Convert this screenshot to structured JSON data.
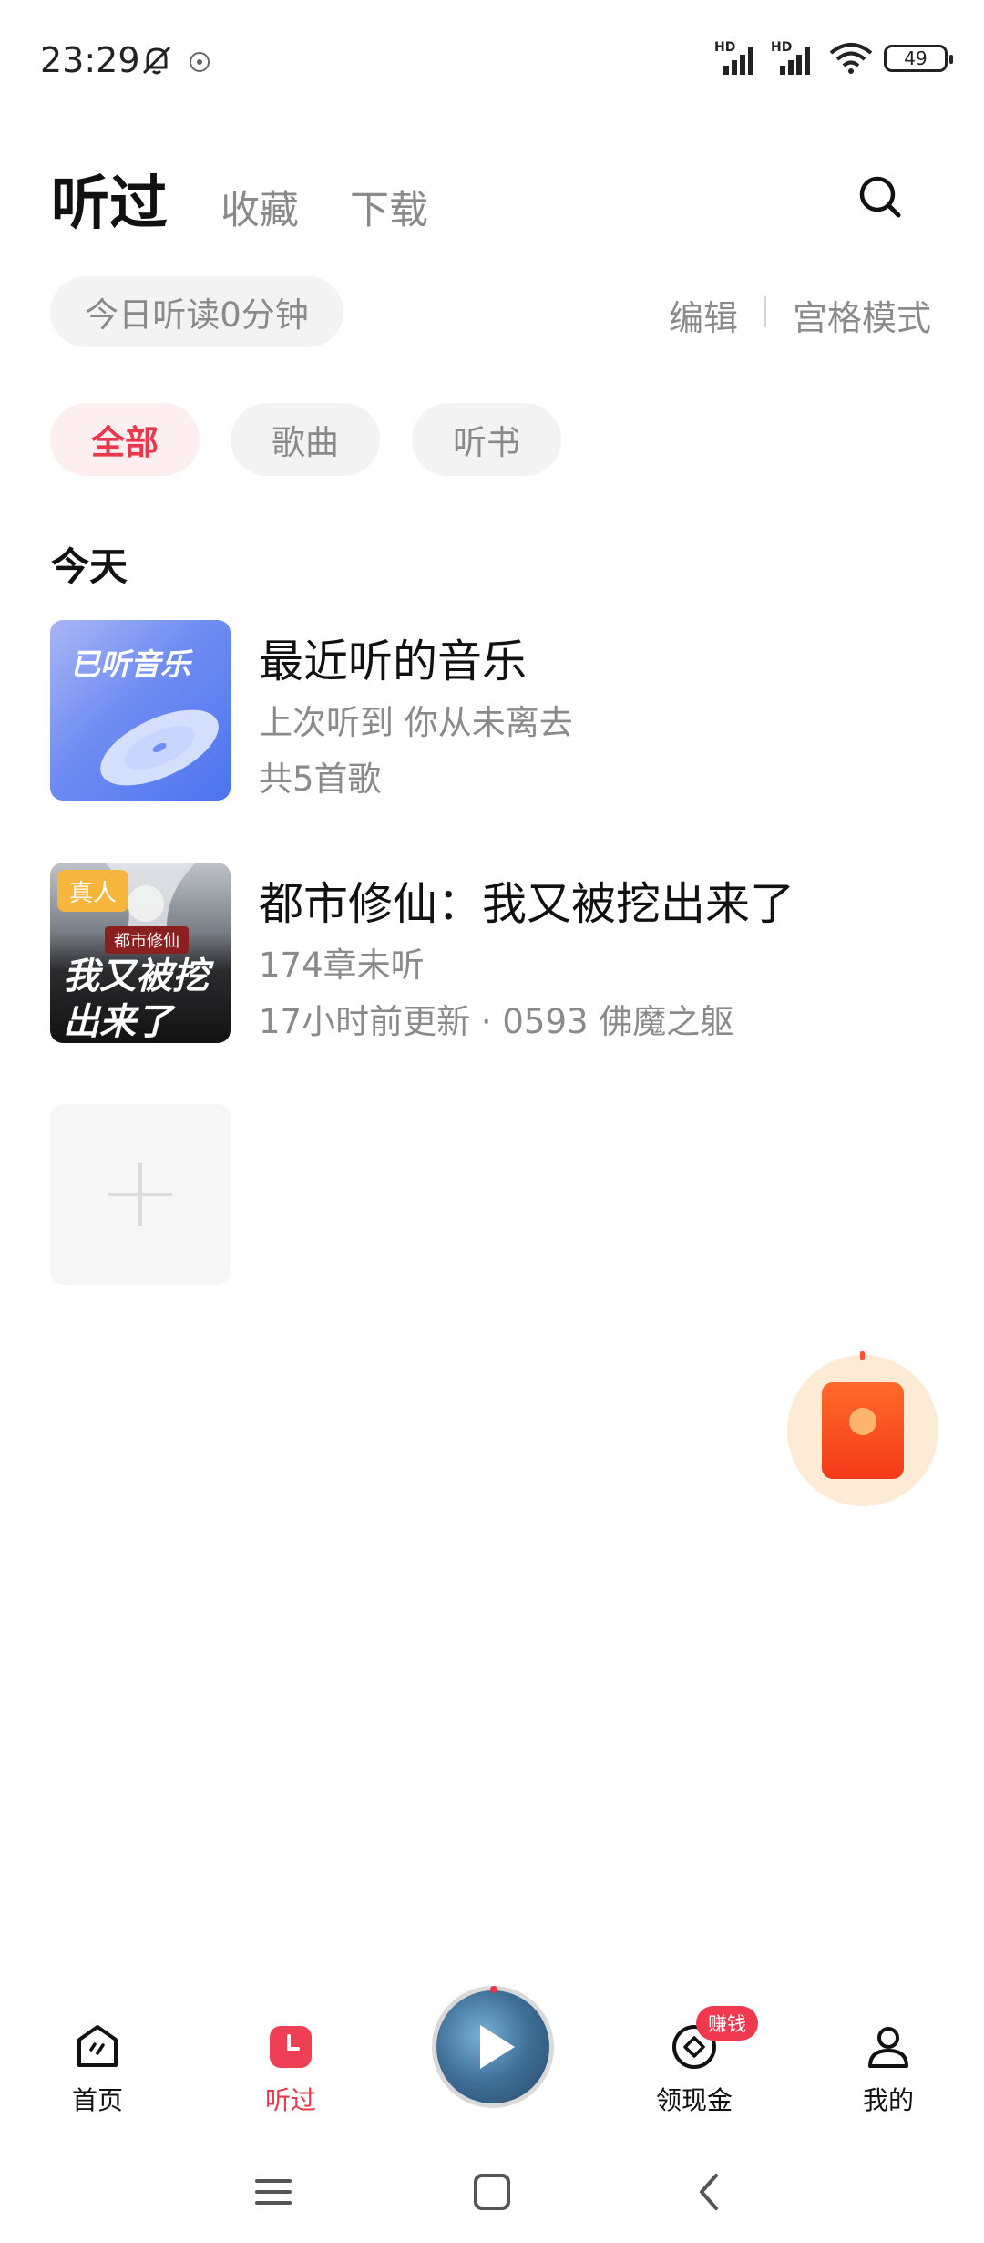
{
  "status_bar": {
    "time": "23:29",
    "signal1": "HD",
    "signal2": "HD",
    "battery": "49"
  },
  "header": {
    "tabs": [
      {
        "label": "听过",
        "active": true
      },
      {
        "label": "收藏",
        "active": false
      },
      {
        "label": "下载",
        "active": false
      }
    ],
    "search_icon": "search-icon"
  },
  "info_row": {
    "today": "今日听读0分钟",
    "edit": "编辑",
    "grid_mode": "宫格模式"
  },
  "filters": [
    {
      "label": "全部",
      "active": true
    },
    {
      "label": "歌曲",
      "active": false
    },
    {
      "label": "听书",
      "active": false
    }
  ],
  "section": {
    "title": "今天"
  },
  "items": [
    {
      "cover_text": "已听音乐",
      "title": "最近听的音乐",
      "subtitle": "上次听到 你从未离去",
      "meta": "共5首歌"
    },
    {
      "badge": "真人",
      "cover_tag": "都市修仙",
      "cover_calligraphy": "我又被挖出来了",
      "title": "都市修仙：我又被挖出来了",
      "subtitle": "174章未听",
      "meta": "17小时前更新 · 0593  佛魔之躯"
    }
  ],
  "bottom_nav": {
    "items": [
      {
        "label": "首页",
        "icon": "home-icon",
        "active": false
      },
      {
        "label": "听过",
        "icon": "history-icon",
        "active": true
      },
      {
        "label": "领现金",
        "icon": "coin-icon",
        "active": false,
        "badge": "赚钱"
      },
      {
        "label": "我的",
        "icon": "profile-icon",
        "active": false
      }
    ],
    "player_icon": "play-icon"
  },
  "colors": {
    "accent": "#e8384e",
    "muted_text": "#8a8a8a",
    "pill_bg": "#f3f3f3"
  }
}
